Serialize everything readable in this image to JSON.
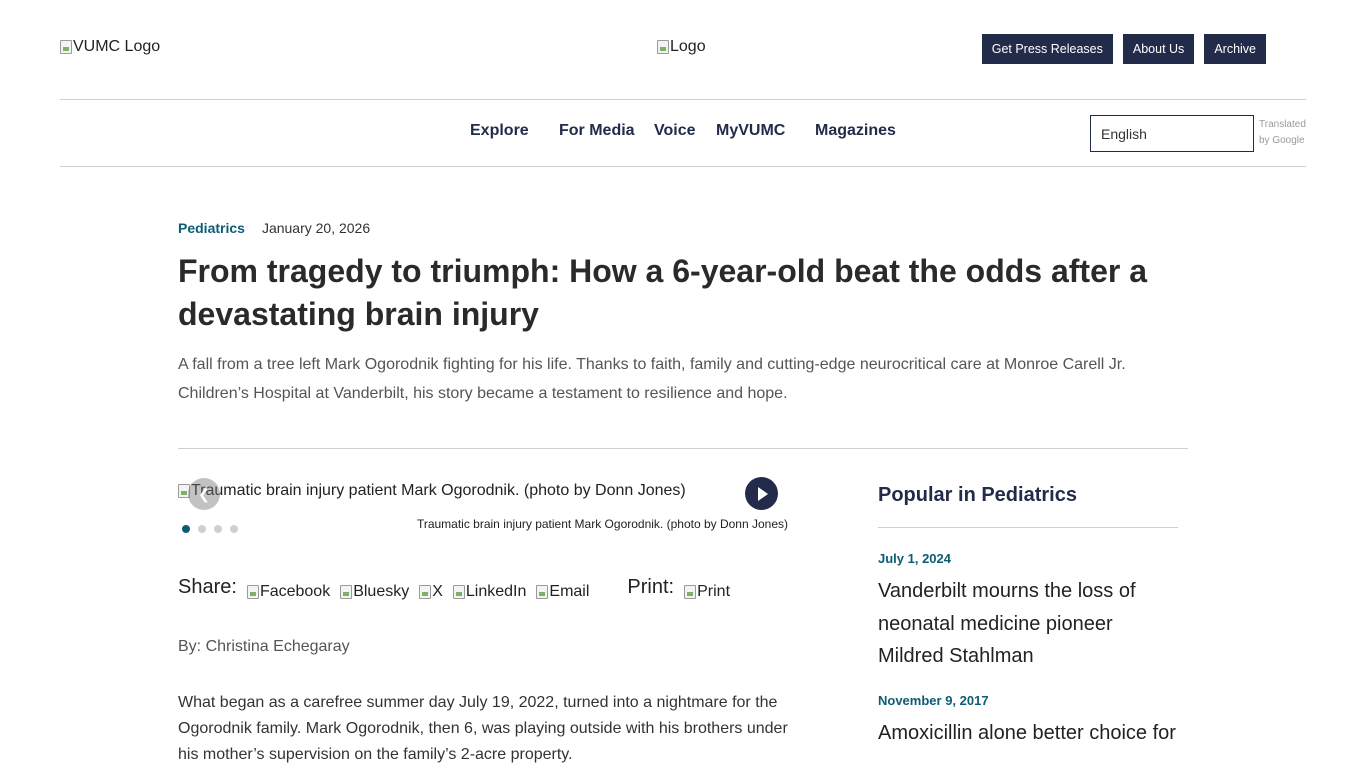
{
  "header": {
    "vumc_logo_alt": "VUMC Logo",
    "center_logo_alt": "Logo",
    "buttons": [
      "Get Press Releases",
      "About Us",
      "Archive"
    ]
  },
  "nav": {
    "items": [
      "Explore",
      "For Media",
      "Voice",
      "MyVUMC",
      "Magazines"
    ],
    "language": "English",
    "translated_line1": "Translated",
    "translated_line2": "by Google"
  },
  "article": {
    "category": "Pediatrics",
    "date": "January 20, 2026",
    "title": "From tragedy to triumph: How a 6-year-old beat the odds after a devastating brain injury",
    "dek": "A fall from a tree left Mark Ogorodnik fighting for his life. Thanks to faith, family and cutting-edge neurocritical care at Monroe Carell Jr. Children’s Hospital at Vanderbilt, his story became a testament to resilience and hope.",
    "image_alt": "Traumatic brain injury patient Mark Ogorodnik. (photo by Donn Jones)",
    "caption": "Traumatic brain injury patient Mark Ogorodnik. (photo by Donn Jones)",
    "slide_count": 4,
    "active_slide": 1,
    "share_label": "Share:",
    "share_links": [
      "Facebook",
      "Bluesky",
      "X",
      "LinkedIn",
      "Email"
    ],
    "print_label": "Print:",
    "print_link": "Print",
    "byline": "By: Christina Echegaray",
    "body_first_paragraph": "What began as a carefree summer day July 19, 2022, turned into a nightmare for the Ogorodnik family. Mark Ogorodnik, then 6, was playing outside with his brothers under his mother’s supervision on the family’s 2-acre property."
  },
  "sidebar": {
    "title": "Popular in Pediatrics",
    "items": [
      {
        "date": "July 1, 2024",
        "headline": "Vanderbilt mourns the loss of neonatal medicine pioneer Mildred Stahlman"
      },
      {
        "date": "November 9, 2017",
        "headline": "Amoxicillin alone better choice for"
      }
    ]
  }
}
